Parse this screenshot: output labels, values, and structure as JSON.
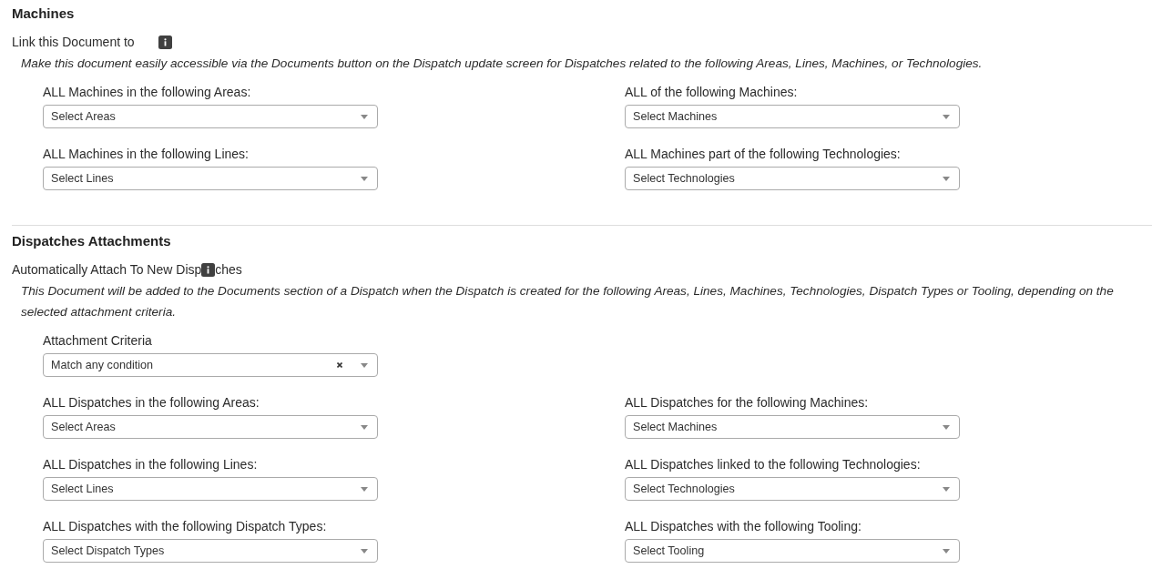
{
  "sections": [
    {
      "title": "Machines",
      "label": {
        "before_icon": "Link this Document to"
      },
      "description": "Make this document easily accessible via the Documents button on the Dispatch update screen for Dispatches related to the following Areas, Lines, Machines, or Technologies.",
      "fields": [
        {
          "label": "ALL Machines in the following Areas:",
          "placeholder": "Select Areas"
        },
        {
          "label": "ALL of the following Machines:",
          "placeholder": "Select Machines"
        },
        {
          "label": "ALL Machines in the following Lines:",
          "placeholder": "Select Lines"
        },
        {
          "label": "ALL Machines part of the following Technologies:",
          "placeholder": "Select Technologies"
        }
      ]
    },
    {
      "title": "Dispatches Attachments",
      "label": {
        "before_icon": "Automatically Attach To New Disp",
        "after_icon": "ches"
      },
      "description": "This Document will be added to the Documents section of a Dispatch when the Dispatch is created for the following Areas, Lines, Machines, Technologies, Dispatch Types or Tooling, depending on the selected attachment criteria.",
      "criteria": {
        "label": "Attachment Criteria",
        "value": "Match any condition",
        "clear_button": true
      },
      "fields": [
        {
          "label": "ALL Dispatches in the following Areas:",
          "placeholder": "Select Areas"
        },
        {
          "label": "ALL Dispatches for the following Machines:",
          "placeholder": "Select Machines"
        },
        {
          "label": "ALL Dispatches in the following Lines:",
          "placeholder": "Select Lines"
        },
        {
          "label": "ALL Dispatches linked to the following Technologies:",
          "placeholder": "Select Technologies"
        },
        {
          "label": "ALL Dispatches with the following Dispatch Types:",
          "placeholder": "Select Dispatch Types"
        },
        {
          "label": "ALL Dispatches with the following Tooling:",
          "placeholder": "Select Tooling"
        }
      ]
    }
  ]
}
